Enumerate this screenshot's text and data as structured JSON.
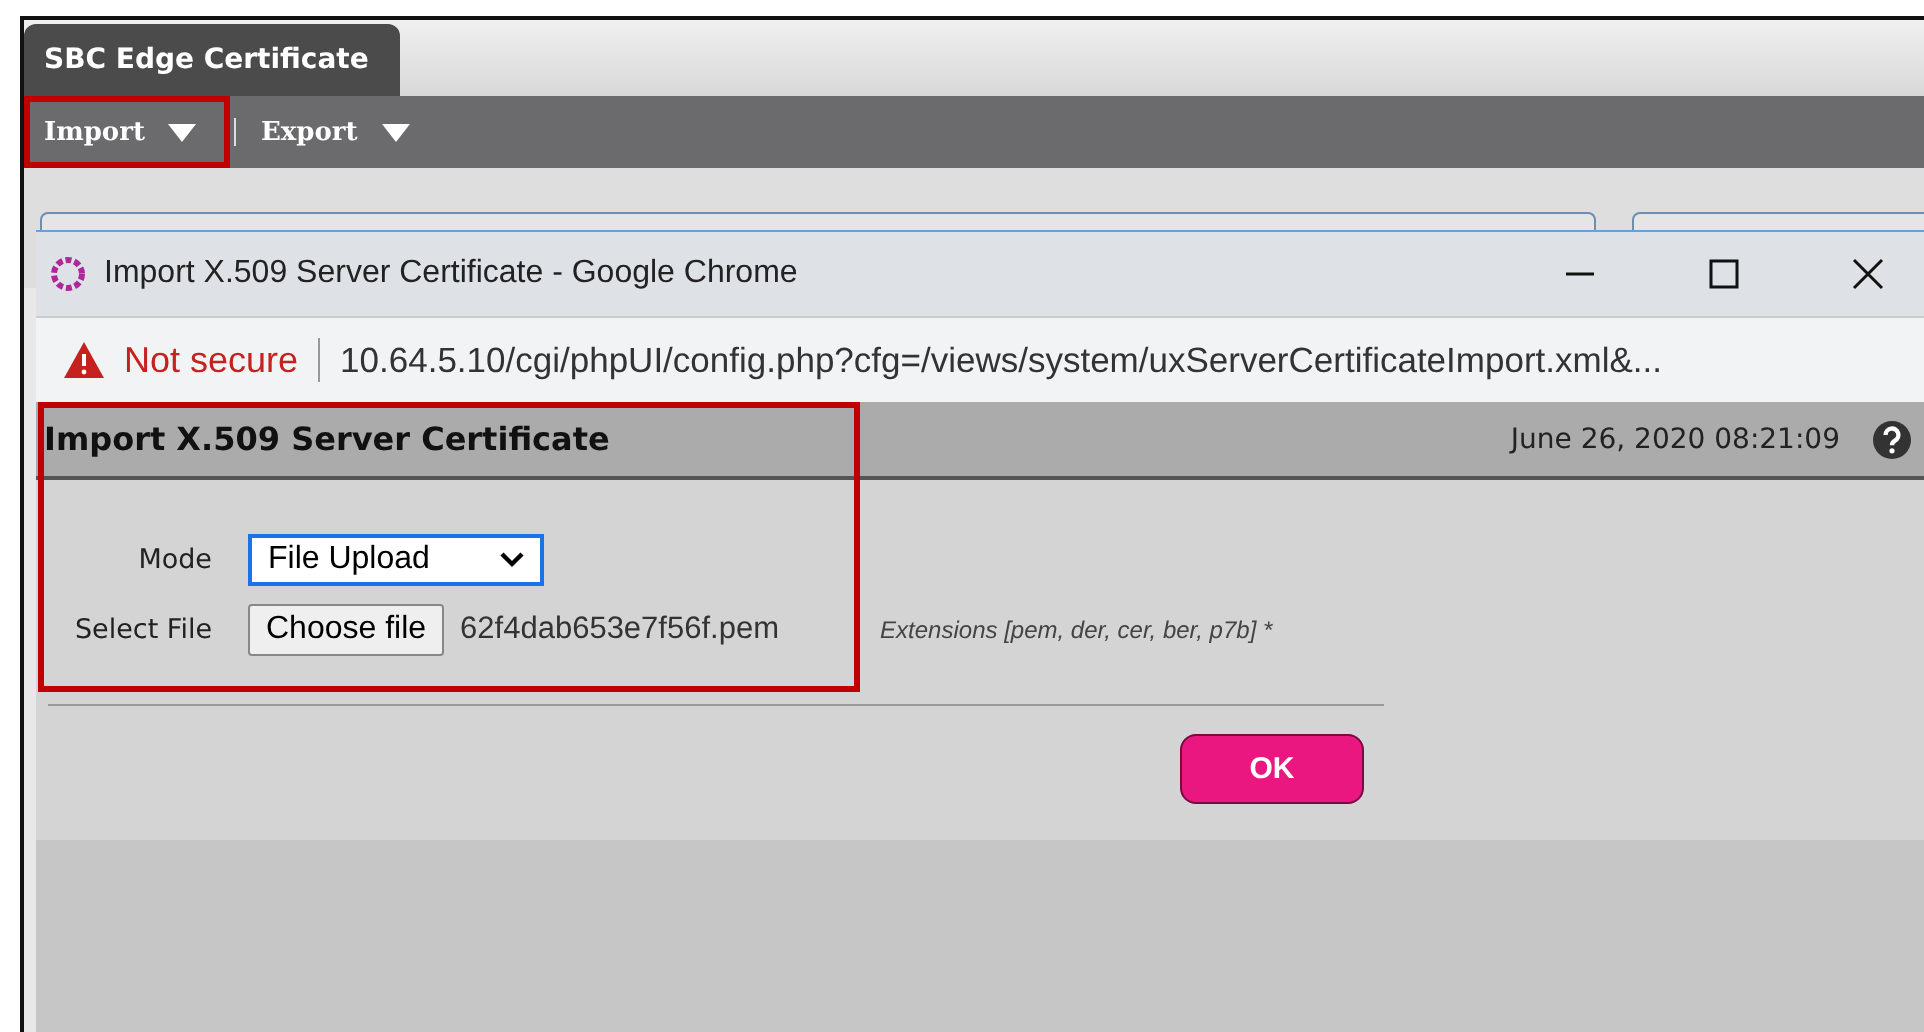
{
  "app_tab": {
    "label": "SBC Edge Certificate",
    "selected": true
  },
  "toolbar": {
    "menus": [
      {
        "label": "Import",
        "highlighted": true
      },
      {
        "label": "Export",
        "highlighted": false
      }
    ]
  },
  "popup": {
    "window_title": "Import X.509 Server Certificate - Google Chrome",
    "security_label": "Not secure",
    "url": "10.64.5.10/cgi/phpUI/config.php?cfg=/views/system/uxServerCertificateImport.xml&...",
    "header": {
      "title": "Import X.509 Server Certificate",
      "timestamp": "June 26, 2020 08:21:09"
    },
    "form": {
      "highlighted": true,
      "mode_label": "Mode",
      "mode_value": "File Upload",
      "file_label": "Select File",
      "file_button": "Choose file",
      "file_name": "62f4dab653e7f56f.pem",
      "hint": "Extensions [pem, der, cer, ber, p7b] *"
    },
    "ok_button": "OK"
  }
}
